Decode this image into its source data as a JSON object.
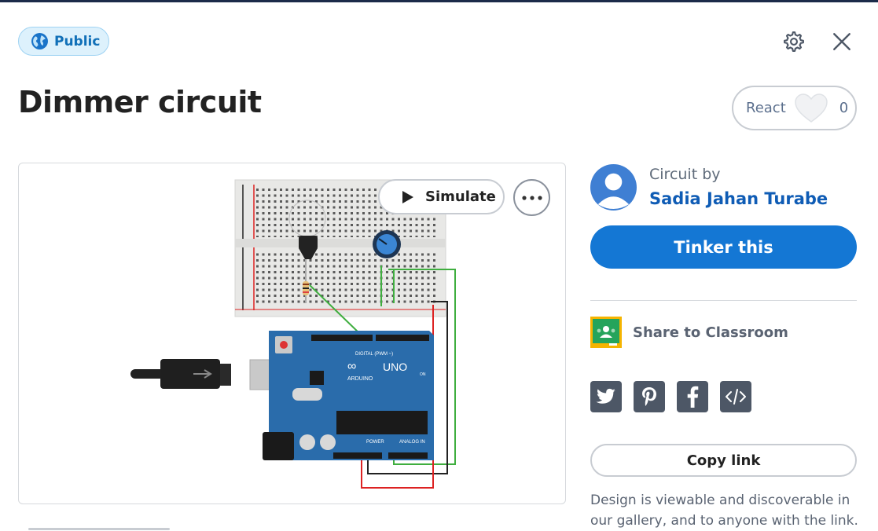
{
  "visibility": {
    "label": "Public",
    "icon": "globe-icon"
  },
  "header": {
    "settings_icon": "gear-icon",
    "close_icon": "close-icon"
  },
  "design": {
    "title": "Dimmer circuit"
  },
  "reactions": {
    "label": "React",
    "count": "0",
    "icon": "heart-icon"
  },
  "canvas": {
    "simulate_label": "Simulate",
    "more_icon": "more-options-icon",
    "board_labels": {
      "digital": "DIGITAL (PWM ~)",
      "uno": "UNO",
      "arduino": "ARDUINO",
      "power": "POWER",
      "analog": "ANALOG IN",
      "on": "ON"
    }
  },
  "author": {
    "caption": "Circuit by",
    "name": "Sadia Jahan Turabe"
  },
  "actions": {
    "tinker_label": "Tinker this",
    "classroom_label": "Share to Classroom",
    "share_icons": [
      "twitter-icon",
      "pinterest-icon",
      "facebook-icon",
      "embed-code-icon"
    ],
    "copy_link_label": "Copy link"
  },
  "footer": {
    "description": "Design is viewable and discoverable in our gallery, and to anyone with the link."
  },
  "colors": {
    "primary": "#1477d4",
    "author_link": "#0f5cb5",
    "badge_bg": "#ddf1fc",
    "share_bg": "#4d5766"
  }
}
